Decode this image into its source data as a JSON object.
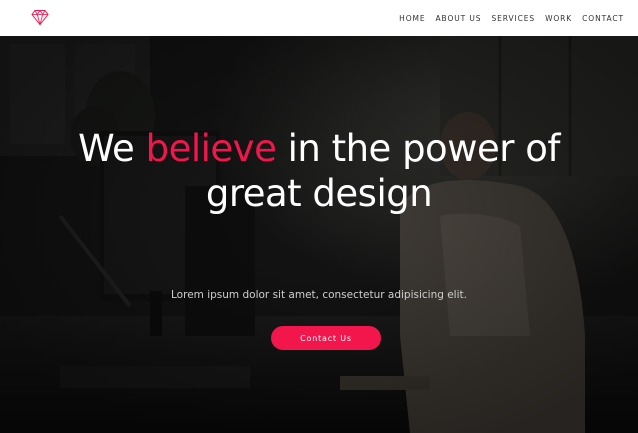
{
  "header": {
    "logo_icon": "diamond-icon",
    "nav_items": [
      {
        "label": "HOME"
      },
      {
        "label": "ABOUT US"
      },
      {
        "label": "SERVICES"
      },
      {
        "label": "WORK"
      },
      {
        "label": "CONTACT"
      }
    ]
  },
  "hero": {
    "headline_before": "We",
    "headline_accent": "believe",
    "headline_after": "in the power of great design",
    "subtitle": "Lorem ipsum dolor sit amet, consectetur adipisicing elit.",
    "cta_label": "Contact Us"
  },
  "colors": {
    "accent": "#f2164d",
    "header_background": "#ffffff",
    "hero_text": "#ffffff"
  }
}
